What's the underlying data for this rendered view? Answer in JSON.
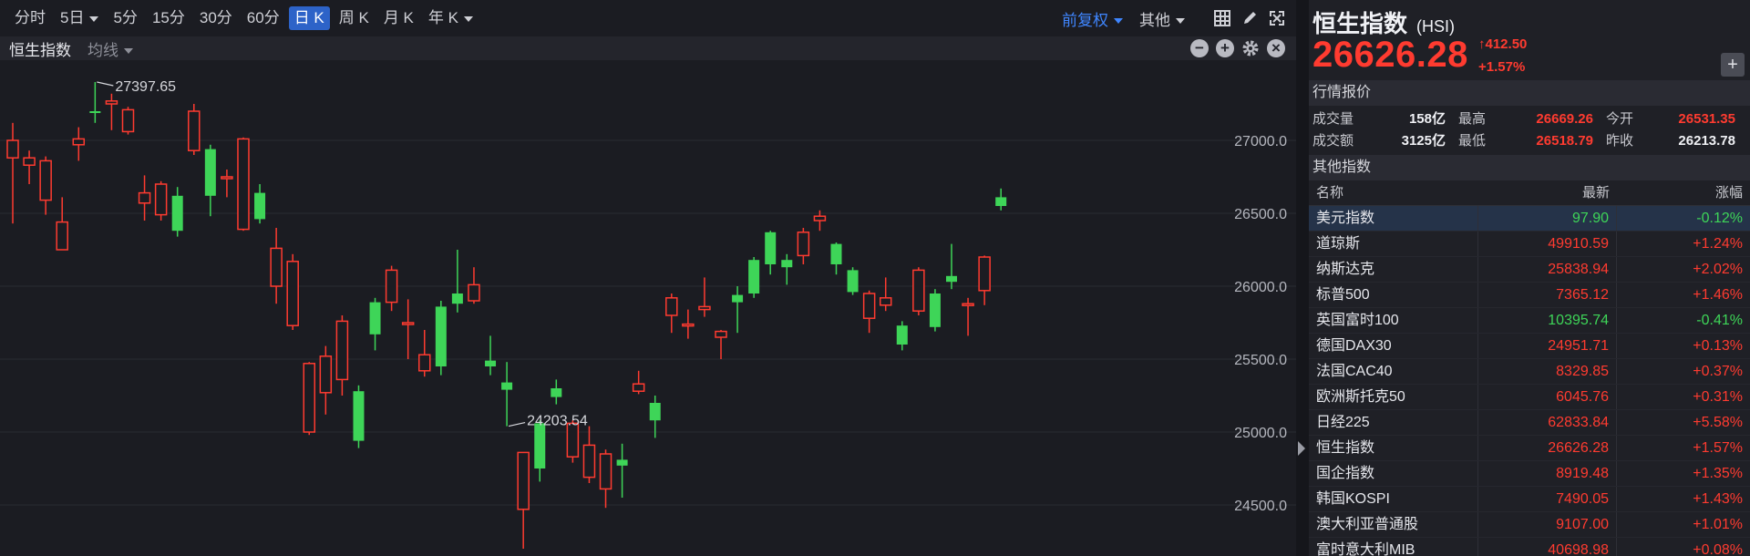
{
  "toolbar": {
    "timeframes": [
      {
        "label": "分时",
        "active": false,
        "dropdown": false
      },
      {
        "label": "5日",
        "active": false,
        "dropdown": true
      },
      {
        "label": "5分",
        "active": false,
        "dropdown": false
      },
      {
        "label": "15分",
        "active": false,
        "dropdown": false
      },
      {
        "label": "30分",
        "active": false,
        "dropdown": false
      },
      {
        "label": "60分",
        "active": false,
        "dropdown": false
      },
      {
        "label": "日 K",
        "active": true,
        "dropdown": false
      },
      {
        "label": "周 K",
        "active": false,
        "dropdown": false
      },
      {
        "label": "月 K",
        "active": false,
        "dropdown": false
      },
      {
        "label": "年 K",
        "active": false,
        "dropdown": true
      }
    ],
    "adjust_label": "前复权",
    "other_label": "其他",
    "icons": [
      "grid-icon",
      "draw-pen-icon",
      "zoom-fit-icon",
      "fullscreen-icon"
    ]
  },
  "subbar": {
    "symbol_label": "恒生指数",
    "ma_label": "均线",
    "icons": [
      "zoom-out-icon",
      "zoom-in-icon",
      "settings-icon",
      "close-icon"
    ]
  },
  "chart_data": {
    "type": "candlestick",
    "y_ticks": [
      24500,
      25000,
      25500,
      26000,
      26500,
      27000
    ],
    "y_tick_labels": [
      "24500.0",
      "25000.0",
      "25500.0",
      "26000.0",
      "26500.0",
      "27000.0"
    ],
    "ylim": [
      24150,
      27550
    ],
    "colors": {
      "up": "#ff3b30",
      "down": "#3ed558"
    },
    "high_marker": {
      "label": "27397.65",
      "index": 5
    },
    "low_marker": {
      "label": "24203.54",
      "index": 30
    },
    "candles": [
      [
        26880,
        27000,
        27120,
        26430
      ],
      [
        26830,
        26880,
        26930,
        26700
      ],
      [
        26590,
        26860,
        26890,
        26490
      ],
      [
        26250,
        26440,
        26610,
        26280
      ],
      [
        26970,
        27010,
        27090,
        26860
      ],
      [
        27200,
        27190,
        27400,
        27120
      ],
      [
        27250,
        27270,
        27320,
        27070
      ],
      [
        27060,
        27210,
        27230,
        27040
      ],
      [
        26570,
        26640,
        26760,
        26450
      ],
      [
        26490,
        26700,
        26720,
        26450
      ],
      [
        26620,
        26380,
        26680,
        26340
      ],
      [
        26930,
        27200,
        27250,
        26900
      ],
      [
        26940,
        26620,
        26970,
        26480
      ],
      [
        26740,
        26750,
        26800,
        26610
      ],
      [
        26390,
        27010,
        27020,
        26380
      ],
      [
        26640,
        26460,
        26700,
        26430
      ],
      [
        26000,
        26260,
        26400,
        25880
      ],
      [
        25730,
        26170,
        26220,
        25700
      ],
      [
        25000,
        25470,
        25480,
        24980
      ],
      [
        25270,
        25520,
        25590,
        25120
      ],
      [
        25360,
        25760,
        25800,
        25250
      ],
      [
        25280,
        24940,
        25320,
        24890
      ],
      [
        25890,
        25670,
        25920,
        25560
      ],
      [
        25890,
        26110,
        26140,
        25830
      ],
      [
        25750,
        25750,
        25910,
        25500
      ],
      [
        25420,
        25530,
        25700,
        25380
      ],
      [
        25860,
        25450,
        25900,
        25390
      ],
      [
        25950,
        25880,
        26250,
        25820
      ],
      [
        25900,
        26010,
        26130,
        25880
      ],
      [
        25490,
        25450,
        25660,
        25390
      ],
      [
        25340,
        25290,
        25480,
        25040
      ],
      [
        24470,
        24860,
        24860,
        24200
      ],
      [
        25060,
        24750,
        25080,
        24660
      ],
      [
        25300,
        25240,
        25360,
        25190
      ],
      [
        24830,
        25060,
        25080,
        24790
      ],
      [
        24690,
        24910,
        25040,
        24650
      ],
      [
        24610,
        24850,
        24880,
        24480
      ],
      [
        24810,
        24770,
        24920,
        24550
      ],
      [
        25280,
        25330,
        25420,
        25260
      ],
      [
        25200,
        25080,
        25250,
        24960
      ],
      [
        25800,
        25920,
        25950,
        25680
      ],
      [
        25740,
        25740,
        25840,
        25640
      ],
      [
        25840,
        25860,
        26060,
        25790
      ],
      [
        25650,
        25690,
        25700,
        25500
      ],
      [
        25940,
        25890,
        26000,
        25680
      ],
      [
        26180,
        25950,
        26200,
        25920
      ],
      [
        26370,
        26150,
        26380,
        26080
      ],
      [
        26180,
        26130,
        26220,
        26010
      ],
      [
        26210,
        26370,
        26400,
        26150
      ],
      [
        26450,
        26480,
        26520,
        26380
      ],
      [
        26290,
        26150,
        26300,
        26080
      ],
      [
        26110,
        25960,
        26130,
        25940
      ],
      [
        25780,
        25950,
        25970,
        25680
      ],
      [
        25870,
        25920,
        26060,
        25830
      ],
      [
        25730,
        25600,
        25760,
        25560
      ],
      [
        25830,
        26110,
        26130,
        25800
      ],
      [
        25950,
        25720,
        25980,
        25690
      ],
      [
        26070,
        26030,
        26290,
        25980
      ],
      [
        25880,
        25880,
        25920,
        25660
      ],
      [
        25970,
        26200,
        26210,
        25870
      ],
      [
        26610,
        26550,
        26670,
        26520
      ]
    ]
  },
  "quote": {
    "name": "恒生指数",
    "code": "(HSI)",
    "price": "26626.28",
    "change": "412.50",
    "change_pct": "+1.57%",
    "add_label": "+"
  },
  "market": {
    "section_title": "行情报价",
    "rows": [
      [
        {
          "label": "成交量",
          "value": "158亿",
          "color": "white"
        },
        {
          "label": "最高",
          "value": "26669.26",
          "color": "red"
        },
        {
          "label": "今开",
          "value": "26531.35",
          "color": "red"
        }
      ],
      [
        {
          "label": "成交额",
          "value": "3125亿",
          "color": "white"
        },
        {
          "label": "最低",
          "value": "26518.79",
          "color": "red"
        },
        {
          "label": "昨收",
          "value": "26213.78",
          "color": "white"
        }
      ]
    ]
  },
  "indices": {
    "section_title": "其他指数",
    "headers": {
      "name": "名称",
      "last": "最新",
      "change": "涨幅"
    },
    "rows": [
      {
        "name": "美元指数",
        "last": "97.90",
        "change": "-0.12%",
        "color": "green",
        "selected": true
      },
      {
        "name": "道琼斯",
        "last": "49910.59",
        "change": "+1.24%",
        "color": "red",
        "selected": false
      },
      {
        "name": "纳斯达克",
        "last": "25838.94",
        "change": "+2.02%",
        "color": "red",
        "selected": false
      },
      {
        "name": "标普500",
        "last": "7365.12",
        "change": "+1.46%",
        "color": "red",
        "selected": false
      },
      {
        "name": "英国富时100",
        "last": "10395.74",
        "change": "-0.41%",
        "color": "green",
        "selected": false
      },
      {
        "name": "德国DAX30",
        "last": "24951.71",
        "change": "+0.13%",
        "color": "red",
        "selected": false
      },
      {
        "name": "法国CAC40",
        "last": "8329.85",
        "change": "+0.37%",
        "color": "red",
        "selected": false
      },
      {
        "name": "欧洲斯托克50",
        "last": "6045.76",
        "change": "+0.31%",
        "color": "red",
        "selected": false
      },
      {
        "name": "日经225",
        "last": "62833.84",
        "change": "+5.58%",
        "color": "red",
        "selected": false
      },
      {
        "name": "恒生指数",
        "last": "26626.28",
        "change": "+1.57%",
        "color": "red",
        "selected": false
      },
      {
        "name": "国企指数",
        "last": "8919.48",
        "change": "+1.35%",
        "color": "red",
        "selected": false
      },
      {
        "name": "韩国KOSPI",
        "last": "7490.05",
        "change": "+1.43%",
        "color": "red",
        "selected": false
      },
      {
        "name": "澳大利亚普通股",
        "last": "9107.00",
        "change": "+1.01%",
        "color": "red",
        "selected": false
      },
      {
        "name": "富时意大利MIB",
        "last": "40698.98",
        "change": "+0.08%",
        "color": "red",
        "selected": false
      }
    ]
  }
}
